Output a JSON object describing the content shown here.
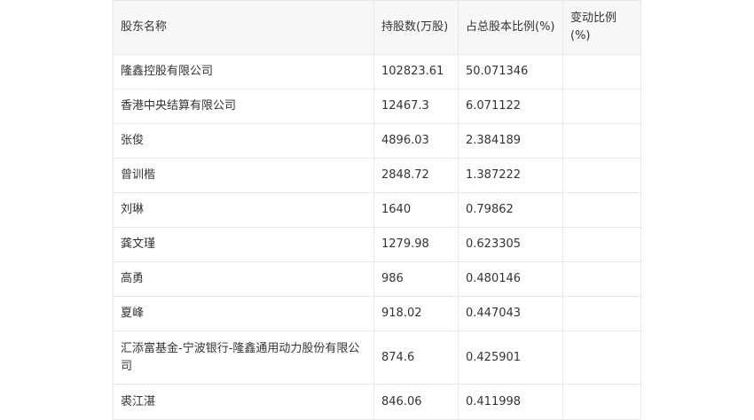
{
  "table": {
    "headers": [
      "股东名称",
      "持股数(万股)",
      "占总股本比例(%)",
      "变动比例(%)"
    ],
    "rows": [
      [
        "隆鑫控股有限公司",
        "102823.61",
        "50.071346",
        ""
      ],
      [
        "香港中央结算有限公司",
        "12467.3",
        "6.071122",
        ""
      ],
      [
        "张俊",
        "4896.03",
        "2.384189",
        ""
      ],
      [
        "曾训楷",
        "2848.72",
        "1.387222",
        ""
      ],
      [
        "刘琳",
        "1640",
        "0.79862",
        ""
      ],
      [
        "龚文瑾",
        "1279.98",
        "0.623305",
        ""
      ],
      [
        "高勇",
        "986",
        "0.480146",
        ""
      ],
      [
        "夏峰",
        "918.02",
        "0.447043",
        ""
      ],
      [
        "汇添富基金-宁波银行-隆鑫通用动力股份有限公司",
        "874.6",
        "0.425901",
        ""
      ],
      [
        "裘江湛",
        "846.06",
        "0.411998",
        ""
      ]
    ]
  }
}
